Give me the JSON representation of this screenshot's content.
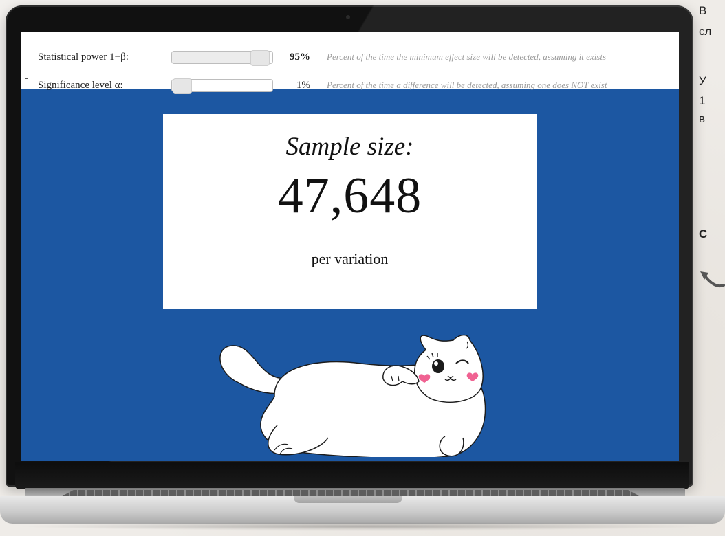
{
  "controls": {
    "power": {
      "label": "Statistical power 1−β:",
      "value": "95%",
      "fraction": 0.95,
      "hint": "Percent of the time the minimum effect size will be detected, assuming it exists"
    },
    "significance": {
      "label": "Significance level α:",
      "value": "1%",
      "fraction": 0.01,
      "hint": "Percent of the time a difference will be detected, assuming one does NOT exist"
    }
  },
  "result": {
    "title": "Sample size:",
    "value": "47,648",
    "unit": "per variation"
  },
  "side_text": {
    "lines": [
      "В",
      "сл",
      "У",
      "1",
      "в"
    ],
    "bold": "С"
  },
  "colors": {
    "screen_bg": "#1c57a2",
    "card_bg": "#ffffff",
    "heart": "#f06292",
    "cat": "#ffffff"
  },
  "icons": {
    "illustration": "cat-illustration",
    "arrow": "curved-arrow-icon"
  }
}
